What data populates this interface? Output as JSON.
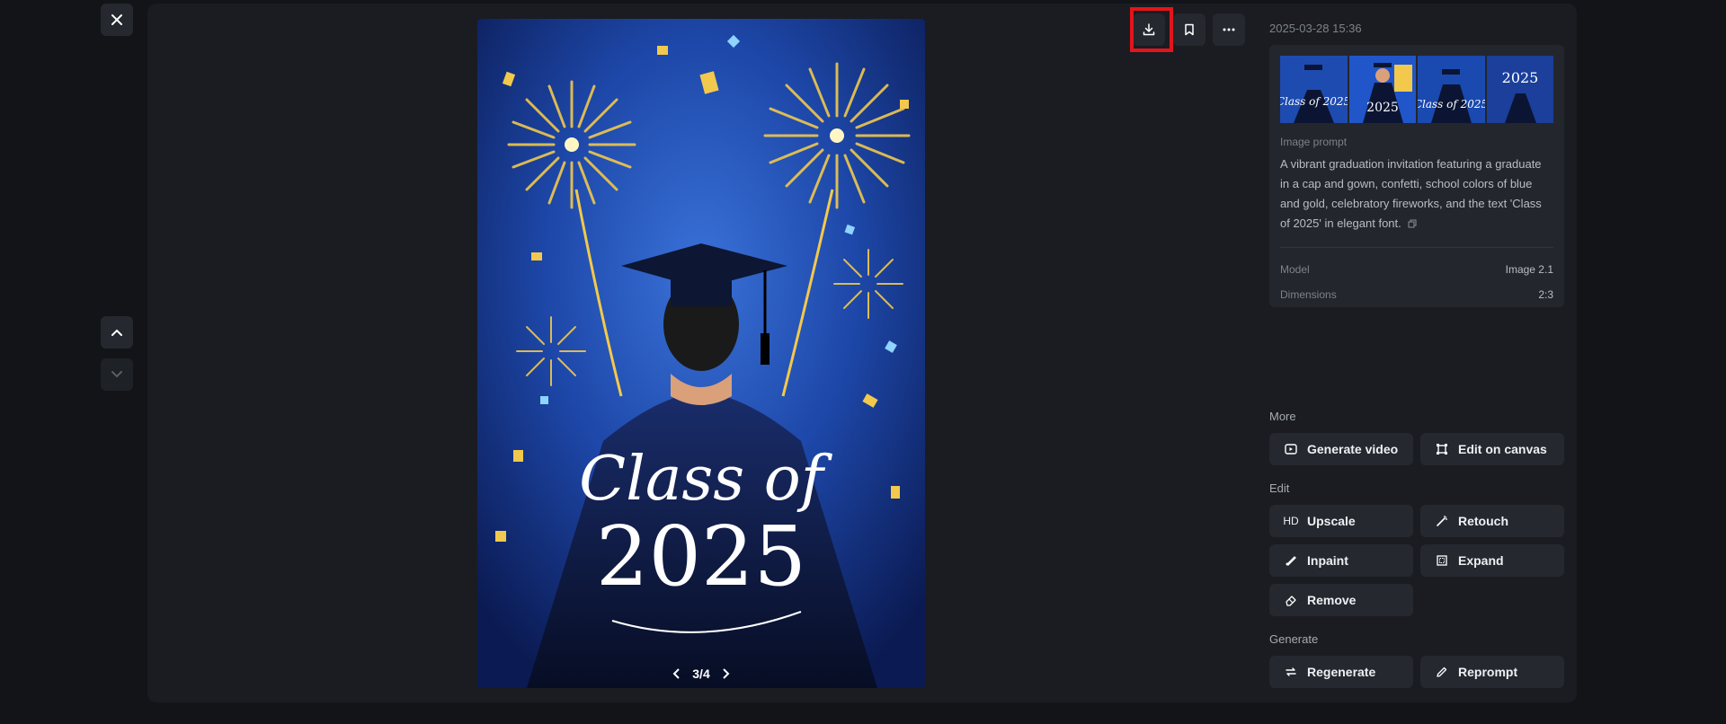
{
  "header": {
    "timestamp": "2025-03-28 15:36"
  },
  "toolbar": {
    "close_icon": "close-icon",
    "download_icon": "download-icon",
    "bookmark_icon": "bookmark-icon",
    "more_icon": "more-horizontal-icon",
    "highlight_color": "#e3151a"
  },
  "navigation": {
    "up_icon": "chevron-up-icon",
    "down_icon": "chevron-down-icon"
  },
  "image": {
    "pager": "3/4",
    "artwork_text_line1": "Class of",
    "artwork_text_line2": "2025",
    "thumbnail_texts": [
      "Class of 2025",
      "2025",
      "Class of 2025",
      "2025"
    ]
  },
  "info": {
    "prompt_label": "Image prompt",
    "prompt_text": "A vibrant graduation invitation featuring a graduate in a cap and gown, confetti, school colors of blue and gold, celebratory fireworks, and the text 'Class of 2025' in elegant font.",
    "model_label": "Model",
    "model_value": "Image 2.1",
    "dimensions_label": "Dimensions",
    "dimensions_value": "2:3"
  },
  "sections": {
    "more": {
      "title": "More",
      "items": [
        {
          "label": "Generate video",
          "icon": "video-icon"
        },
        {
          "label": "Edit on canvas",
          "icon": "canvas-icon"
        }
      ]
    },
    "edit": {
      "title": "Edit",
      "items": [
        {
          "label": "Upscale",
          "icon": "HD"
        },
        {
          "label": "Retouch",
          "icon": "retouch-icon"
        },
        {
          "label": "Inpaint",
          "icon": "inpaint-icon"
        },
        {
          "label": "Expand",
          "icon": "expand-icon"
        },
        {
          "label": "Remove",
          "icon": "eraser-icon"
        }
      ]
    },
    "generate": {
      "title": "Generate",
      "items": [
        {
          "label": "Regenerate",
          "icon": "regenerate-icon"
        },
        {
          "label": "Reprompt",
          "icon": "pencil-icon"
        }
      ]
    }
  },
  "colors": {
    "background": "#121418",
    "panel": "#1a1c21",
    "button": "#25282e",
    "accent_blue": "#1f4fb8",
    "gold": "#f2c94c"
  }
}
